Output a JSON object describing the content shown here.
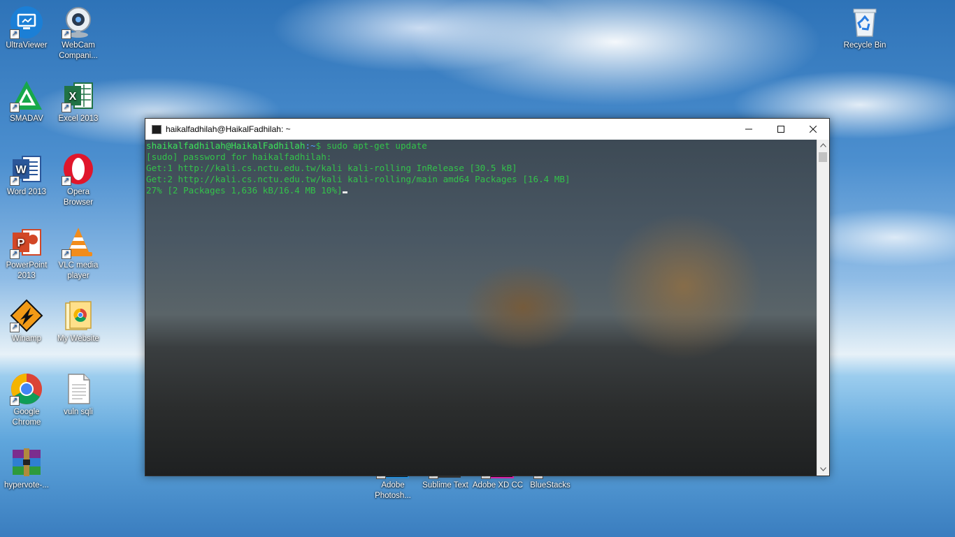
{
  "desktop_icons": [
    {
      "label": "UltraViewer",
      "icon": "ultraviewer-icon"
    },
    {
      "label": "WebCam Compani...",
      "icon": "webcam-icon"
    },
    {
      "label": "SMADAV",
      "icon": "smadav-icon"
    },
    {
      "label": "Excel 2013",
      "icon": "excel-icon"
    },
    {
      "label": "Word 2013",
      "icon": "word-icon"
    },
    {
      "label": "Opera Browser",
      "icon": "opera-icon"
    },
    {
      "label": "PowerPoint 2013",
      "icon": "powerpoint-icon"
    },
    {
      "label": "VLC media player",
      "icon": "vlc-icon"
    },
    {
      "label": "Winamp",
      "icon": "winamp-icon"
    },
    {
      "label": "My Website",
      "icon": "chrome-folder-icon"
    },
    {
      "label": "Google Chrome",
      "icon": "chrome-icon"
    },
    {
      "label": "vuln sqli",
      "icon": "document-icon"
    },
    {
      "label": "hypervote-...",
      "icon": "winrar-icon"
    },
    {
      "label": "Recycle Bin",
      "icon": "recycle-bin-icon"
    },
    {
      "label": "Adobe Photosh...",
      "icon": "photoshop-icon"
    },
    {
      "label": "Sublime Text",
      "icon": "sublime-icon"
    },
    {
      "label": "Adobe XD CC",
      "icon": "adobe-xd-icon"
    },
    {
      "label": "BlueStacks",
      "icon": "bluestacks-icon"
    }
  ],
  "terminal": {
    "title": "haikalfadhilah@HaikalFadhilah: ~",
    "prompt_user": "shaikalfadhilah@HaikalFadhilah",
    "prompt_path": ":~",
    "prompt_symbol": "$",
    "command": " sudo apt-get update",
    "lines": [
      "[sudo] password for haikalfadhilah:",
      "Get:1 http://kali.cs.nctu.edu.tw/kali kali-rolling InRelease [30.5 kB]",
      "Get:2 http://kali.cs.nctu.edu.tw/kali kali-rolling/main amd64 Packages [16.4 MB]",
      "27% [2 Packages 1,636 kB/16.4 MB 10%]"
    ]
  },
  "colors": {
    "terminal_text": "#33c24a",
    "prompt_user": "#3be35a",
    "prompt_path": "#4ea3ff",
    "titlebar": "#ffffff"
  }
}
